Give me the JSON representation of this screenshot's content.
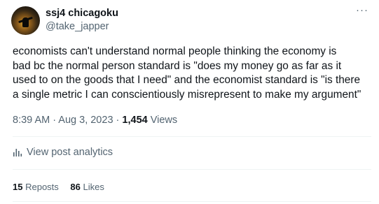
{
  "author": {
    "display_name": "ssj4 chicagoku",
    "handle": "@take_japper"
  },
  "more_menu_label": "···",
  "tweet": {
    "text": "economists can't understand normal people thinking the economy is\nbad bc the normal person standard is \"does my money go as far as it\nused to on the goods that I need\" and the economist standard is \"is there\na single metric I can conscientiously misrepresent to make my argument\"",
    "time": "8:39 AM",
    "separator": " · ",
    "date": "Aug 3, 2023",
    "views_count": "1,454",
    "views_label": "Views"
  },
  "analytics": {
    "label": "View post analytics",
    "icon": "bar-chart-icon"
  },
  "stats": {
    "reposts_count": "15",
    "reposts_label": "Reposts",
    "likes_count": "86",
    "likes_label": "Likes"
  }
}
